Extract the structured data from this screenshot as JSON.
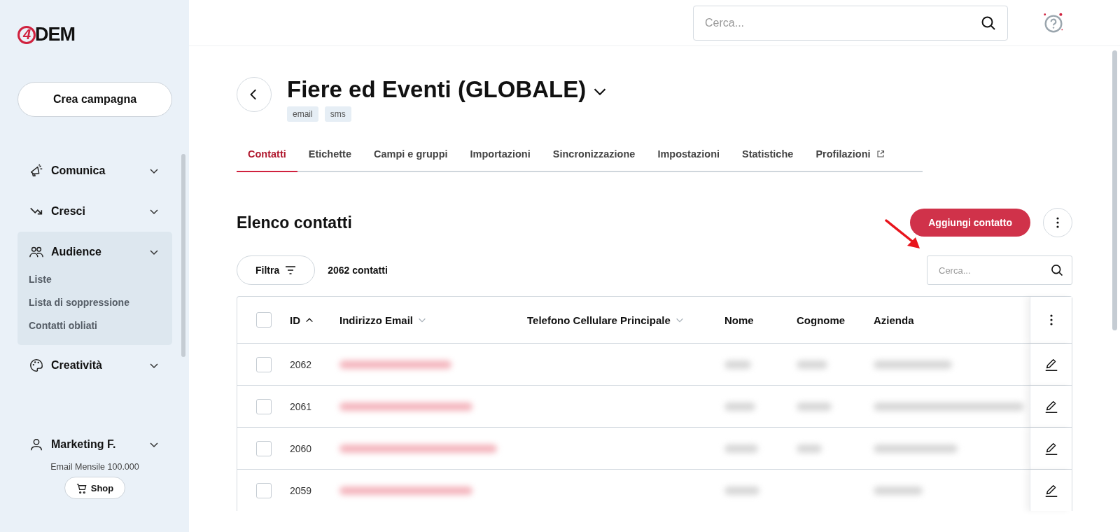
{
  "logo": {
    "mark": "4",
    "text": "DEM"
  },
  "sidebar": {
    "create_button": "Crea campagna",
    "items": [
      {
        "label": "Comunica",
        "selected": false
      },
      {
        "label": "Cresci",
        "selected": false
      },
      {
        "label": "Audience",
        "selected": true,
        "children": [
          "Liste",
          "Lista di soppressione",
          "Contatti obliati"
        ]
      },
      {
        "label": "Creatività",
        "selected": false
      }
    ],
    "account": {
      "name": "Marketing F.",
      "plan": "Email Mensile 100.000",
      "shop_button": "Shop"
    }
  },
  "header": {
    "search": {
      "placeholder": "Cerca..."
    }
  },
  "page": {
    "title": "Fiere ed Eventi (GLOBALE)",
    "tags": [
      "email",
      "sms"
    ],
    "tabs": [
      {
        "label": "Contatti",
        "selected": true,
        "external": false
      },
      {
        "label": "Etichette",
        "selected": false,
        "external": false
      },
      {
        "label": "Campi e gruppi",
        "selected": false,
        "external": false
      },
      {
        "label": "Importazioni",
        "selected": false,
        "external": false
      },
      {
        "label": "Sincronizzazione",
        "selected": false,
        "external": false
      },
      {
        "label": "Impostazioni",
        "selected": false,
        "external": false
      },
      {
        "label": "Statistiche",
        "selected": false,
        "external": false
      },
      {
        "label": "Profilazioni",
        "selected": false,
        "external": true
      }
    ]
  },
  "list": {
    "heading": "Elenco contatti",
    "add_button": "Aggiungi contatto",
    "filter_button": "Filtra",
    "count": "2062 contatti",
    "search": {
      "placeholder": "Cerca..."
    }
  },
  "table": {
    "columns": [
      {
        "label": "ID",
        "sorted": true
      },
      {
        "label": "Indirizzo Email",
        "sorted": false
      },
      {
        "label": "Telefono Cellulare Principale",
        "sorted": false
      },
      {
        "label": "Nome"
      },
      {
        "label": "Cognome"
      },
      {
        "label": "Azienda"
      }
    ],
    "header_checked": false,
    "rows": [
      {
        "id": "2062",
        "checked": false
      },
      {
        "id": "2061",
        "checked": false
      },
      {
        "id": "2060",
        "checked": false
      },
      {
        "id": "2059",
        "checked": false
      }
    ]
  }
}
